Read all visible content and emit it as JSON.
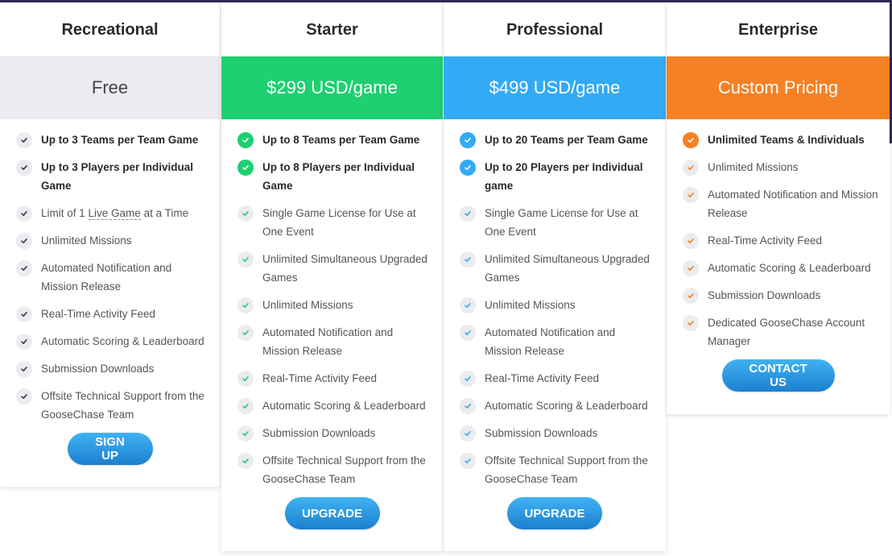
{
  "colors": {
    "free": "#ebebf0",
    "starter": "#1dd070",
    "professional": "#33aaf5",
    "enterprise": "#f58124",
    "button": "#2494e0"
  },
  "plans": [
    {
      "name": "Recreational",
      "price": "Free",
      "features": [
        {
          "text": "Up to 3 Teams per Team Game",
          "highlight": true
        },
        {
          "text": "Up to 3 Players per Individual Game",
          "highlight": true
        },
        {
          "pre": "Limit of 1 ",
          "link": "Live Game",
          "post": " at a Time",
          "highlight": false
        },
        {
          "text": "Unlimited Missions",
          "highlight": false
        },
        {
          "text": "Automated Notification and Mission Release",
          "highlight": false
        },
        {
          "text": "Real-Time Activity Feed",
          "highlight": false
        },
        {
          "text": "Automatic Scoring & Leaderboard",
          "highlight": false
        },
        {
          "text": "Submission Downloads",
          "highlight": false
        },
        {
          "text": "Offsite Technical Support from the GooseChase Team",
          "highlight": false
        }
      ],
      "cta": "SIGN UP"
    },
    {
      "name": "Starter",
      "price": "$299 USD/game",
      "features": [
        {
          "text": "Up to 8 Teams per Team Game",
          "highlight": true
        },
        {
          "text": "Up to 8 Players per Individual Game",
          "highlight": true
        },
        {
          "text": "Single Game License for Use at One Event",
          "highlight": false
        },
        {
          "text": "Unlimited Simultaneous Upgraded Games",
          "highlight": false
        },
        {
          "text": "Unlimited Missions",
          "highlight": false
        },
        {
          "text": "Automated Notification and Mission Release",
          "highlight": false
        },
        {
          "text": "Real-Time Activity Feed",
          "highlight": false
        },
        {
          "text": "Automatic Scoring & Leaderboard",
          "highlight": false
        },
        {
          "text": "Submission Downloads",
          "highlight": false
        },
        {
          "text": "Offsite Technical Support from the GooseChase Team",
          "highlight": false
        }
      ],
      "cta": "UPGRADE"
    },
    {
      "name": "Professional",
      "price": "$499 USD/game",
      "features": [
        {
          "text": "Up to 20 Teams per Team Game",
          "highlight": true
        },
        {
          "text": "Up to 20 Players per Individual game",
          "highlight": true
        },
        {
          "text": "Single Game License for Use at One Event",
          "highlight": false
        },
        {
          "text": "Unlimited Simultaneous Upgraded Games",
          "highlight": false
        },
        {
          "text": "Unlimited Missions",
          "highlight": false
        },
        {
          "text": "Automated Notification and Mission Release",
          "highlight": false
        },
        {
          "text": "Real-Time Activity Feed",
          "highlight": false
        },
        {
          "text": "Automatic Scoring & Leaderboard",
          "highlight": false
        },
        {
          "text": "Submission Downloads",
          "highlight": false
        },
        {
          "text": "Offsite Technical Support from the GooseChase Team",
          "highlight": false
        }
      ],
      "cta": "UPGRADE"
    },
    {
      "name": "Enterprise",
      "price": "Custom Pricing",
      "features": [
        {
          "text": "Unlimited Teams & Individuals",
          "highlight": true
        },
        {
          "text": "Unlimited Missions",
          "highlight": false
        },
        {
          "text": "Automated Notification and Mission Release",
          "highlight": false
        },
        {
          "text": "Real-Time Activity Feed",
          "highlight": false
        },
        {
          "text": "Automatic Scoring & Leaderboard",
          "highlight": false
        },
        {
          "text": "Submission Downloads",
          "highlight": false
        },
        {
          "text": "Dedicated GooseChase Account Manager",
          "highlight": false
        }
      ],
      "cta": "CONTACT US"
    }
  ]
}
